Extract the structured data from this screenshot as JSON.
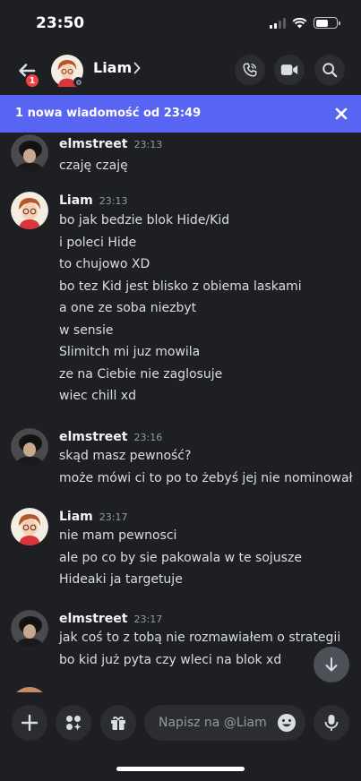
{
  "status_bar": {
    "time": "23:50"
  },
  "header": {
    "back_badge": "1",
    "contact_name": "Liam",
    "chevron": "›"
  },
  "banner": {
    "text": "1 nowa wiadomość od 23:49"
  },
  "messages": [
    {
      "author": "elmstreet",
      "time": "23:13",
      "lines": [
        "czaję czaję"
      ]
    },
    {
      "author": "Liam",
      "time": "23:13",
      "lines": [
        "bo jak bedzie blok Hide/Kid",
        "i poleci Hide",
        "to chujowo XD",
        "bo tez Kid jest blisko z obiema laskami",
        "a one ze soba niezbyt",
        "w sensie",
        "Slimitch mi juz mowila",
        "ze na Ciebie nie zaglosuje",
        "wiec chill xd"
      ]
    },
    {
      "author": "elmstreet",
      "time": "23:16",
      "lines": [
        "skąd masz pewność?",
        "może mówi ci to po to żebyś jej nie nominował"
      ]
    },
    {
      "author": "Liam",
      "time": "23:17",
      "lines": [
        "nie mam pewnosci",
        "ale po co by sie pakowala w te sojusze",
        "Hideaki ja targetuje"
      ]
    },
    {
      "author": "elmstreet",
      "time": "23:17",
      "lines": [
        "jak coś to z tobą nie rozmawiałem o strategii",
        "bo kid już pyta czy wleci na blok xd"
      ]
    }
  ],
  "composer": {
    "placeholder": "Napisz na @Liam"
  },
  "icons": {
    "back": "arrow-left-icon",
    "call": "phone-icon",
    "video": "video-camera-icon",
    "search": "search-icon",
    "close": "close-icon",
    "add": "plus-icon",
    "apps": "apps-icon",
    "gift": "gift-icon",
    "emoji": "emoji-icon",
    "mic": "microphone-icon",
    "scroll": "arrow-down-icon"
  },
  "colors": {
    "background": "#1e1f22",
    "banner": "#5865f2",
    "badge": "#f23f43"
  }
}
